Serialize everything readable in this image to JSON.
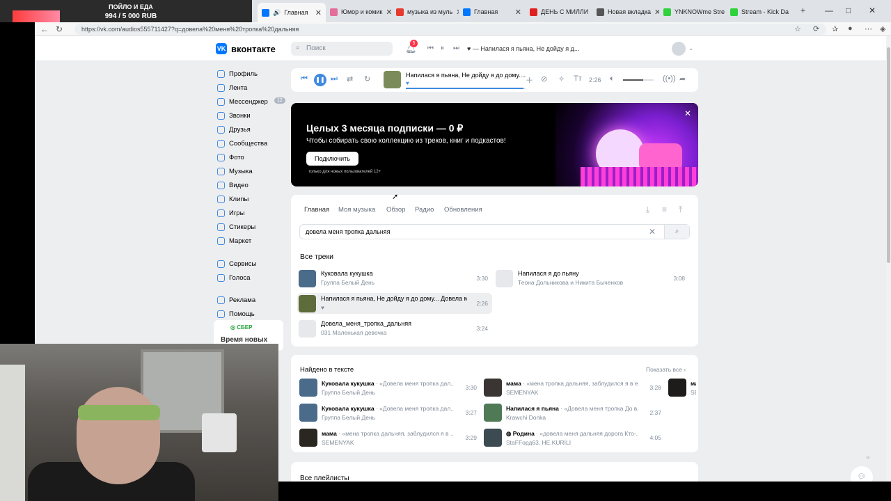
{
  "donation": {
    "title": "ПОЙЛО И ЕДА",
    "amount": "994 / 5 000 RUB"
  },
  "browser": {
    "tabs": [
      {
        "label": "Главная",
        "active": true,
        "color": "#0077ff"
      },
      {
        "label": "Юмор и комик",
        "color": "#e46d9a"
      },
      {
        "label": "музыка из муль",
        "color": "#e63a2e"
      },
      {
        "label": "Главная",
        "color": "#0077ff"
      },
      {
        "label": "ДЕНЬ С МИЛЛИ",
        "color": "#e02020"
      },
      {
        "label": "Новая вкладка",
        "color": "#555555"
      },
      {
        "label": "YNKNOWme Stre",
        "color": "#2fd13c"
      },
      {
        "label": "Stream - Kick Da",
        "color": "#2fd13c"
      }
    ],
    "url": "https://vk.com/audios555711427?q=довела%20меня%20тропка%20дальняя"
  },
  "header": {
    "logo": "вконтакте",
    "logo_mark": "VK",
    "search_placeholder": "Поиск",
    "notif_count": "5",
    "now_playing": "♥ — Напилася я пьяна, Не дойду я д..."
  },
  "menu": {
    "items": [
      {
        "label": "Профиль"
      },
      {
        "label": "Лента"
      },
      {
        "label": "Мессенджер",
        "count": "12"
      },
      {
        "label": "Звонки"
      },
      {
        "label": "Друзья"
      },
      {
        "label": "Сообщества"
      },
      {
        "label": "Фото"
      },
      {
        "label": "Музыка"
      },
      {
        "label": "Видео"
      },
      {
        "label": "Клипы"
      },
      {
        "label": "Игры"
      },
      {
        "label": "Стикеры"
      },
      {
        "label": "Маркет"
      }
    ],
    "items2": [
      {
        "label": "Сервисы"
      },
      {
        "label": "Голоса"
      }
    ],
    "items3": [
      {
        "label": "Реклама"
      },
      {
        "label": "Помощь"
      }
    ],
    "sber_logo": "◎ СБЕР",
    "sber_text": "Время новых"
  },
  "player": {
    "title": "Напилася я пьяна, Не дойду я до дому....",
    "heart": "♥",
    "time": "2:26",
    "progress": 0.98,
    "volume": 0.65
  },
  "banner": {
    "title": "Целых 3 месяца подписки — 0 ₽",
    "subtitle": "Чтобы собирать свою коллекцию из треков, книг и подкастов!",
    "button": "Подключить",
    "note": "только для новых пользователей 12+"
  },
  "music": {
    "tabs": [
      "Главная",
      "Моя музыка",
      "Обзор",
      "Радио",
      "Обновления"
    ],
    "search_value": "довела меня тропка дальняя",
    "all_tracks_header": "Все треки",
    "tracks": [
      {
        "title": "Куковала кукушка",
        "artist": "Группа Белый День",
        "duration": "3:30",
        "cover": "#4a6b8a"
      },
      {
        "title": "Напилася я пьяна, Не дойду я до дому... Довела ме...",
        "artist": "♥",
        "duration": "2:26",
        "cover": "#5e6b3a",
        "current": true
      },
      {
        "title": "Довела_меня_тропка_дальняя",
        "artist": "031 Маленькая девочка",
        "duration": "3:24",
        "cover": "#e6e8eb"
      },
      {
        "title": "Напилася я до пьяну",
        "artist": "Теона Дольникова и Никита Быченков",
        "duration": "3:08",
        "cover": "#e6e8eb"
      }
    ]
  },
  "found": {
    "header": "Найдено в тексте",
    "show_all": "Показать все",
    "tracks": [
      {
        "title": "Куковала кукушка",
        "snippet": " · «Довела меня тропка дал...",
        "artist": "Группа Белый День",
        "duration": "3:30",
        "cover": "#4a6b8a"
      },
      {
        "title": "Куковала кукушка",
        "snippet": " · «Довела меня тропка дал...",
        "artist": "Группа Белый День",
        "duration": "3:27",
        "cover": "#4a6b8a"
      },
      {
        "title": "мама",
        "snippet": " · «мена тропка дальняя, заблудился я в ...",
        "artist": "SEMENYAK",
        "duration": "3:29",
        "cover": "#2a2620"
      },
      {
        "title": "мама",
        "snippet": " · «мена тропка дальняя, заблудился я в е...",
        "artist": "SEMENYAK",
        "duration": "3:28",
        "cover": "#3a3532"
      },
      {
        "title": "Напилася я пьяна",
        "snippet": " · «Довела меня тропка До в...",
        "artist": "Krawchi Donka",
        "duration": "2:37",
        "cover": "#4f7a55"
      },
      {
        "title": "◍ Родина",
        "snippet": " · «довела меня дальняя дорога Кто-...",
        "artist": "StaFFорд63, HE.KURILI",
        "duration": "4:05",
        "cover": "#3c4a52"
      },
      {
        "title": "ма",
        "snippet": "",
        "artist": "SE",
        "duration": "",
        "cover": "#1e1c1a"
      }
    ]
  },
  "playlists_header": "Все плейлисты"
}
